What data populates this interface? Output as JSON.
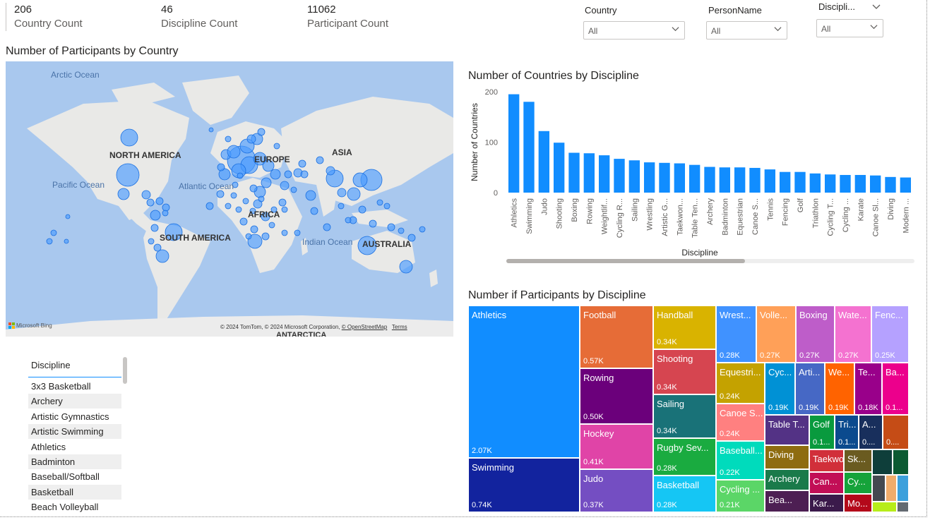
{
  "kpis": [
    {
      "value": "206",
      "label": "Country Count"
    },
    {
      "value": "46",
      "label": "Discipline Count"
    },
    {
      "value": "11062",
      "label": "Participant Count"
    }
  ],
  "slicers": [
    {
      "title": "Country",
      "value": "All"
    },
    {
      "title": "PersonName",
      "value": "All"
    },
    {
      "title": "Discipli...",
      "value": "All"
    }
  ],
  "map": {
    "title": "Number of Participants by Country",
    "ocean_labels": [
      "Arctic Ocean",
      "Pacific Ocean",
      "Atlantic Ocean",
      "Indian Ocean"
    ],
    "continent_labels": [
      "NORTH AMERICA",
      "EUROPE",
      "ASIA",
      "AFRICA",
      "SOUTH AMERICA",
      "AUSTRALIA",
      "ANTARCTICA"
    ],
    "attribution": "© 2024 TomTom, © 2024 Microsoft Corporation,",
    "osm_link": "© OpenStreetMap",
    "terms_link": "Terms",
    "brand": "Microsoft Bing"
  },
  "bar_chart": {
    "title": "Number of Countries by Discipline",
    "xlabel": "Discipline",
    "ylabel": "Number of Countries",
    "bar_color": "#118dff"
  },
  "chart_data": {
    "type": "bar",
    "title": "Number of Countries by Discipline",
    "xlabel": "Discipline",
    "ylabel": "Number of Countries",
    "ylim": [
      0,
      200
    ],
    "yticks": [
      "0",
      "100",
      "200"
    ],
    "categories": [
      "Athletics",
      "Swimming",
      "Judo",
      "Shooting",
      "Boxing",
      "Rowing",
      "Weightlif...",
      "Cycling R...",
      "Sailing",
      "Wrestling",
      "Artistic G...",
      "Taekwon...",
      "Table Ten...",
      "Archery",
      "Badminton",
      "Equestrian",
      "Canoe S...",
      "Tennis",
      "Fencing",
      "Golf",
      "Triathlon",
      "Cycling T...",
      "Cycling ...",
      "Karate",
      "Canoe Sl...",
      "Diving",
      "Modern ..."
    ],
    "values": [
      195,
      180,
      122,
      99,
      79,
      78,
      74,
      67,
      64,
      60,
      59,
      58,
      55,
      51,
      50,
      50,
      49,
      46,
      41,
      41,
      38,
      36,
      35,
      35,
      34,
      31,
      30
    ]
  },
  "treemap": {
    "title": "Number if Participants by Discipline",
    "cells": [
      {
        "name": "Athletics",
        "value": "2.07K",
        "color": "#118dff"
      },
      {
        "name": "Swimming",
        "value": "0.74K",
        "color": "#12239e"
      },
      {
        "name": "Football",
        "value": "0.57K",
        "color": "#e66c37"
      },
      {
        "name": "Rowing",
        "value": "0.50K",
        "color": "#6b007b"
      },
      {
        "name": "Hockey",
        "value": "0.41K",
        "color": "#e044a7"
      },
      {
        "name": "Judo",
        "value": "0.37K",
        "color": "#744ec2"
      },
      {
        "name": "Handball",
        "value": "0.34K",
        "color": "#d9b300"
      },
      {
        "name": "Shooting",
        "value": "0.34K",
        "color": "#d64550"
      },
      {
        "name": "Sailing",
        "value": "0.34K",
        "color": "#197278"
      },
      {
        "name": "Rugby Sev...",
        "value": "0.28K",
        "color": "#1aab40"
      },
      {
        "name": "Basketball",
        "value": "0.28K",
        "color": "#15c6f4"
      },
      {
        "name": "Wrest...",
        "value": "0.28K",
        "color": "#4092ff"
      },
      {
        "name": "Volle...",
        "value": "0.27K",
        "color": "#ffa058"
      },
      {
        "name": "Boxing",
        "value": "0.27K",
        "color": "#be5dc9"
      },
      {
        "name": "Wate...",
        "value": "0.27K",
        "color": "#f472d0"
      },
      {
        "name": "Fenc...",
        "value": "0.25K",
        "color": "#b5a1ff"
      },
      {
        "name": "Equestri...",
        "value": "0.24K",
        "color": "#c4a200"
      },
      {
        "name": "Canoe S...",
        "value": "0.24K",
        "color": "#ff8080"
      },
      {
        "name": "Baseball...",
        "value": "0.22K",
        "color": "#00dbbc"
      },
      {
        "name": "Cycling ...",
        "value": "0.21K",
        "color": "#5bd667"
      },
      {
        "name": "Cyc...",
        "value": "0.19K",
        "color": "#0091d5"
      },
      {
        "name": "Arti...",
        "value": "0.19K",
        "color": "#4668c5"
      },
      {
        "name": "We...",
        "value": "0.19K",
        "color": "#ff6300"
      },
      {
        "name": "Te...",
        "value": "0.18K",
        "color": "#99008a"
      },
      {
        "name": "Ba...",
        "value": "0.1...",
        "color": "#ec008c"
      },
      {
        "name": "Table T...",
        "value": "",
        "color": "#533285"
      },
      {
        "name": "Golf",
        "value": "0.1...",
        "color": "#099a3e"
      },
      {
        "name": "Tri...",
        "value": "0.1...",
        "color": "#0b4a8e"
      },
      {
        "name": "A...",
        "value": "0....",
        "color": "#182f5c"
      },
      {
        "name": "",
        "value": "0....",
        "color": "#c54c16"
      },
      {
        "name": "Diving",
        "value": "",
        "color": "#8e6c10"
      },
      {
        "name": "Taekwo...",
        "value": "",
        "color": "#d12f3a"
      },
      {
        "name": "Archery",
        "value": "",
        "color": "#1a7a4a"
      },
      {
        "name": "Bea...",
        "value": "",
        "color": "#4d1f53"
      },
      {
        "name": "Sk...",
        "value": "",
        "color": "#6a5b20"
      },
      {
        "name": "Can...",
        "value": "",
        "color": "#c20e56"
      },
      {
        "name": "Cy...",
        "value": "",
        "color": "#15a33a"
      },
      {
        "name": "Kar...",
        "value": "",
        "color": "#3b1a4b"
      },
      {
        "name": "Mo...",
        "value": "",
        "color": "#b4081a"
      },
      {
        "name": "",
        "value": "",
        "color": "#0e3e3a"
      },
      {
        "name": "",
        "value": "",
        "color": "#0b5a32"
      },
      {
        "name": "",
        "value": "",
        "color": "#444950"
      },
      {
        "name": "",
        "value": "",
        "color": "#f0ac6b"
      },
      {
        "name": "",
        "value": "",
        "color": "#3ca0dc"
      },
      {
        "name": "",
        "value": "",
        "color": "#b7ed1a"
      },
      {
        "name": "",
        "value": "",
        "color": "#636a71"
      },
      {
        "name": "",
        "value": "",
        "color": "#8fb2f0"
      }
    ]
  },
  "discipline_list": {
    "header": "Discipline",
    "items": [
      "3x3 Basketball",
      "Archery",
      "Artistic Gymnastics",
      "Artistic Swimming",
      "Athletics",
      "Badminton",
      "Baseball/Softball",
      "Basketball",
      "Beach Volleyball"
    ]
  }
}
